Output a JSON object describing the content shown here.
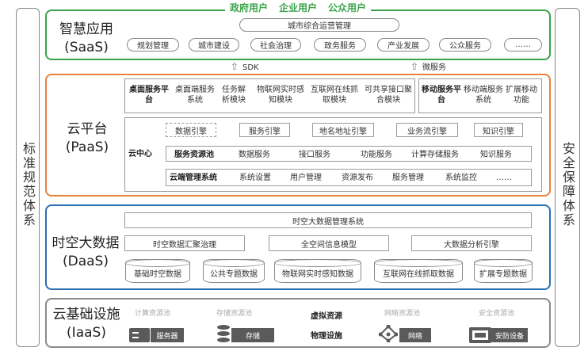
{
  "side": {
    "left": "标准规范体系",
    "right": "安全保障体系"
  },
  "saas": {
    "users": [
      "政府用户",
      "企业用户",
      "公众用户"
    ],
    "name": "智慧应用",
    "code": "(SaaS)",
    "top_bar": "城市综合运营管理",
    "items": [
      "规划管理",
      "城市建设",
      "社会治理",
      "政务服务",
      "产业发展",
      "公众服务",
      "……"
    ]
  },
  "connectors": {
    "left": "SDK",
    "right": "微服务"
  },
  "paas": {
    "name": "云平台",
    "code": "(PaaS)",
    "desktop": {
      "title": "桌面服务平台",
      "items": [
        "桌面端服务系统",
        "任务解析模块",
        "物联网实时感知模块",
        "互联网在线抓取模块",
        "可共享接口聚合模块"
      ]
    },
    "mobile": {
      "title": "移动服务平台",
      "items": [
        "移动端服务系统",
        "扩展移动功能"
      ]
    },
    "cloud_center": "云中心",
    "engines": [
      "数据引擎",
      "服务引擎",
      "地名地址引擎",
      "业务流引擎",
      "知识引擎"
    ],
    "resource_pool": {
      "title": "服务资源池",
      "items": [
        "数据服务",
        "接口服务",
        "功能服务",
        "计算存储服务",
        "知识服务"
      ]
    },
    "cloud_mgmt": {
      "title": "云端管理系统",
      "items": [
        "系统设置",
        "用户管理",
        "资源发布",
        "服务管理",
        "系统监控",
        "……"
      ]
    }
  },
  "daas": {
    "name": "时空大数据",
    "code": "(DaaS)",
    "mgmt": "时空大数据管理系统",
    "modules": [
      "时空数据汇聚治理",
      "全空间信息模型",
      "大数据分析引擎"
    ],
    "databases": [
      "基础时空数据",
      "公共专题数据",
      "物联网实时感知数据",
      "互联网在线抓取数据",
      "扩展专题数据"
    ]
  },
  "iaas": {
    "name": "云基础设施",
    "code": "(IaaS)",
    "pools": [
      "计算资源池",
      "存储资源池",
      "网络资源池",
      "安全资源池"
    ],
    "virtual": "虚拟资源",
    "physical": "物理设施",
    "devices": [
      "服务器",
      "存储",
      "网络",
      "安防设备"
    ]
  },
  "colors": {
    "saas": "#3aa34a",
    "paas": "#e8823a",
    "daas": "#2a6fb3",
    "iaas": "#8a8a8a"
  }
}
